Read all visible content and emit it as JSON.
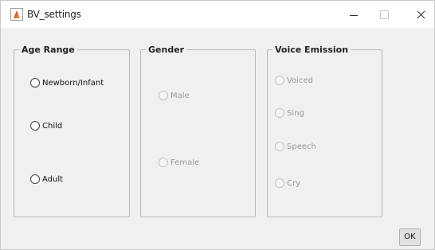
{
  "window": {
    "title": "BV_settings",
    "app_icon": "matlab-icon",
    "controls": [
      "minimize-icon",
      "maximize-icon",
      "close-icon"
    ]
  },
  "groups": {
    "age_range": {
      "title": "Age Range",
      "options": [
        "Newborn/Infant",
        "Child",
        "Adult"
      ],
      "enabled": true
    },
    "gender": {
      "title": "Gender",
      "options": [
        "Male",
        "Female"
      ],
      "enabled": false
    },
    "voice_emission": {
      "title": "Voice Emission",
      "options": [
        "Voiced",
        "Sing",
        "Speech",
        "Cry"
      ],
      "enabled": false
    }
  },
  "ok_button": {
    "label": "OK"
  }
}
